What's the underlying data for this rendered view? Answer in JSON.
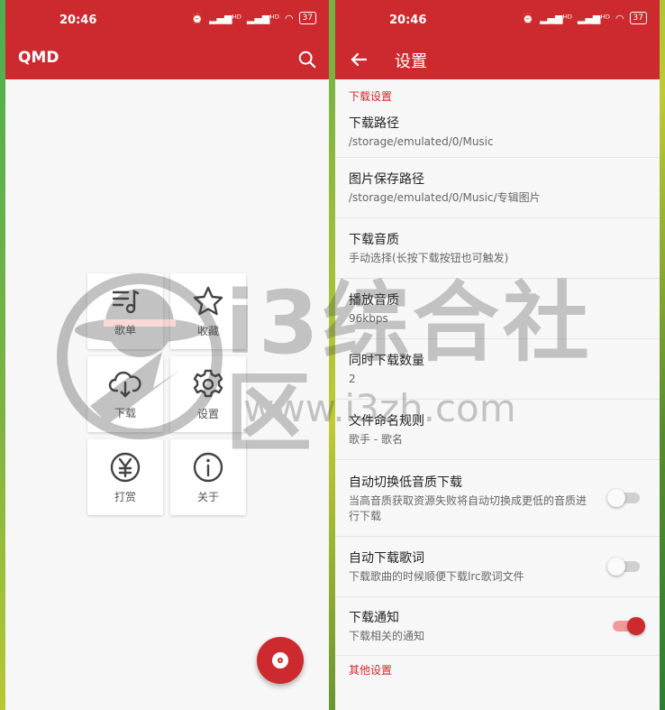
{
  "left": {
    "status": {
      "time": "20:46",
      "signal1": "ᴴᴰ",
      "signal2": "ᴴᴰ",
      "battery": "37"
    },
    "appbar": {
      "title": "QMD"
    },
    "menu": [
      {
        "label": "歌单",
        "icon": "playlist-icon"
      },
      {
        "label": "收藏",
        "icon": "star-icon"
      },
      {
        "label": "下载",
        "icon": "cloud-download-icon"
      },
      {
        "label": "设置",
        "icon": "gear-icon"
      },
      {
        "label": "打赏",
        "icon": "yen-icon"
      },
      {
        "label": "关于",
        "icon": "info-icon"
      }
    ]
  },
  "right": {
    "status": {
      "time": "20:46",
      "signal1": "ᴴᴰ",
      "signal2": "ᴴᴰ",
      "battery": "37"
    },
    "appbar": {
      "title": "设置"
    },
    "section_download": "下载设置",
    "items": [
      {
        "title": "下载路径",
        "summary": "/storage/emulated/0/Music"
      },
      {
        "title": "图片保存路径",
        "summary": "/storage/emulated/0/Music/专辑图片"
      },
      {
        "title": "下载音质",
        "summary": "手动选择(长按下载按钮也可触发)"
      },
      {
        "title": "播放音质",
        "summary": "96kbps"
      },
      {
        "title": "同时下载数量",
        "summary": "2"
      },
      {
        "title": "文件命名规则",
        "summary": "歌手 - 歌名"
      },
      {
        "title": "自动切换低音质下载",
        "summary": "当高音质获取资源失败将自动切换成更低的音质进行下载",
        "toggle": "off"
      },
      {
        "title": "自动下载歌词",
        "summary": "下载歌曲的时候顺便下载lrc歌词文件",
        "toggle": "off"
      },
      {
        "title": "下载通知",
        "summary": "下载相关的通知",
        "toggle": "on"
      }
    ],
    "section_other": "其他设置"
  },
  "watermark": {
    "brand": "i3综合社区",
    "url": "www.i3zh.com"
  },
  "colors": {
    "primary": "#cc2a2e",
    "background": "#f7f7f7"
  }
}
